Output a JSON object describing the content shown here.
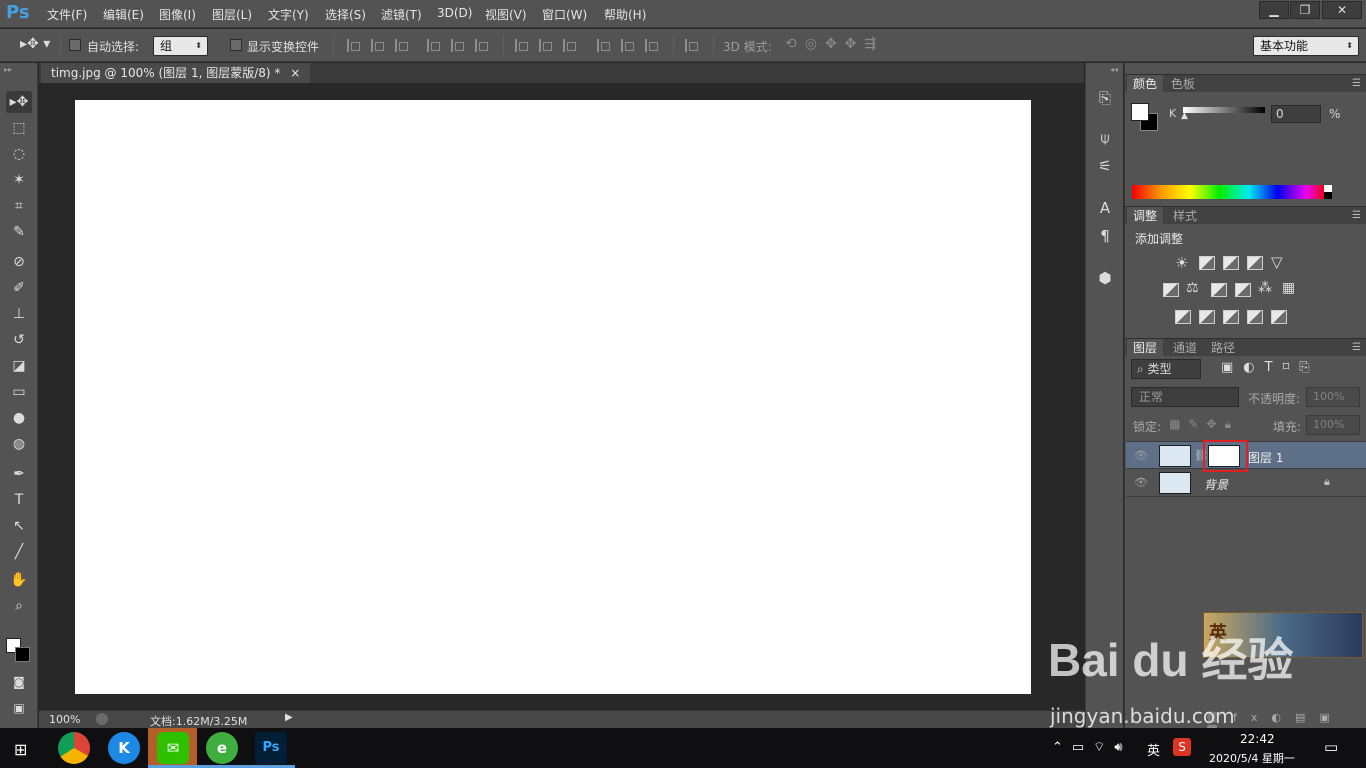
{
  "app": {
    "logo": "Ps"
  },
  "menu": [
    "文件(F)",
    "编辑(E)",
    "图像(I)",
    "图层(L)",
    "文字(Y)",
    "选择(S)",
    "滤镜(T)",
    "3D(D)",
    "视图(V)",
    "窗口(W)",
    "帮助(H)"
  ],
  "window_controls": {
    "minimize": "▁",
    "restore": "❐",
    "close": "✕"
  },
  "options": {
    "auto_select_label": "自动选择:",
    "auto_select_value": "组",
    "transform_label": "显示变换控件",
    "mode_3d_label": "3D 模式:",
    "workspace": "基本功能"
  },
  "document": {
    "tab_title": "timg.jpg @ 100% (图层 1, 图层蒙版/8) *",
    "tab_close": "×",
    "zoom": "100%",
    "doc_size": "文档:1.62M/3.25M"
  },
  "color_panel": {
    "tabs": [
      "颜色",
      "色板"
    ],
    "channel_label": "K",
    "channel_value": "0",
    "percent": "%"
  },
  "adjust_panel": {
    "tabs": [
      "调整",
      "样式"
    ],
    "add_label": "添加调整"
  },
  "layers_panel": {
    "tabs": [
      "图层",
      "通道",
      "路径"
    ],
    "filter_kind": "类型",
    "blend_mode": "正常",
    "opacity_label": "不透明度:",
    "opacity_value": "100%",
    "lock_label": "锁定:",
    "fill_label": "填充:",
    "fill_value": "100%",
    "layers": [
      {
        "name": "图层 1",
        "selected": true,
        "has_mask": true
      },
      {
        "name": "背景",
        "selected": false,
        "locked": true
      }
    ]
  },
  "watermark": {
    "text": "Bai du 经验",
    "url": "jingyan.baidu.com",
    "game_badge": "英"
  },
  "taskbar": {
    "ime": "英",
    "time": "22:42",
    "date": "2020/5/4 星期一"
  },
  "colors": {
    "ui_bg": "#535353",
    "canvas_bg": "#282828",
    "selection_highlight": "#e02020",
    "accent": "#46a0e0"
  }
}
